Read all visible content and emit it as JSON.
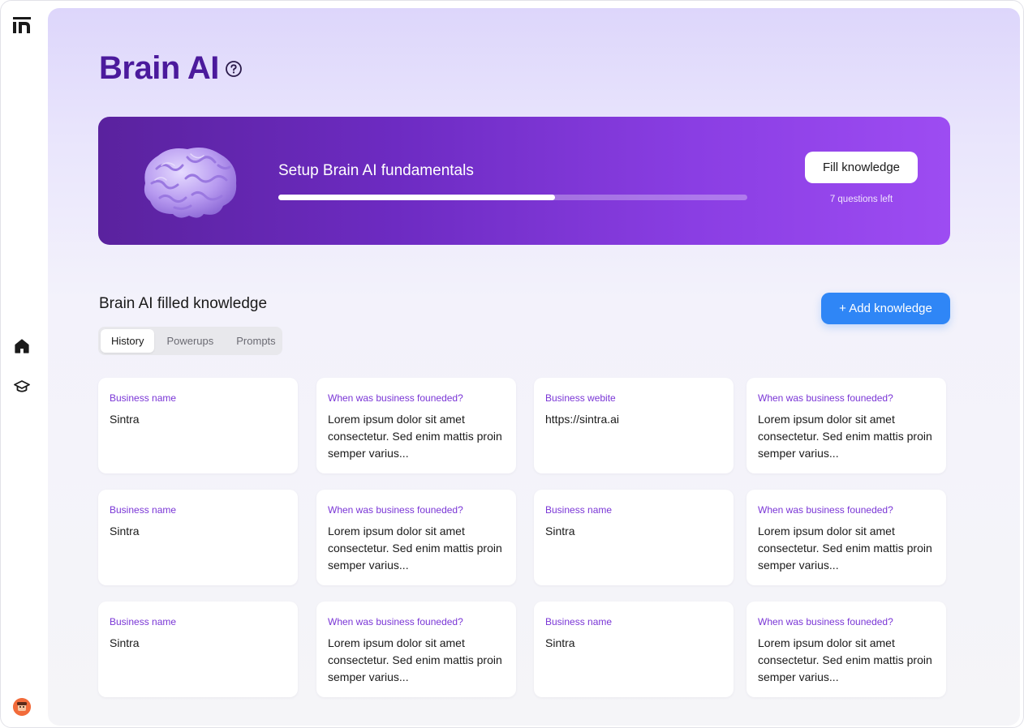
{
  "page": {
    "title": "Brain AI"
  },
  "banner": {
    "title": "Setup Brain AI fundamentals",
    "progress": 0.59,
    "button_label": "Fill knowledge",
    "questions_left": "7 questions left"
  },
  "section": {
    "title": "Brain AI filled knowledge",
    "add_button_label": "+ Add knowledge",
    "tabs": [
      {
        "label": "History",
        "active": true
      },
      {
        "label": "Powerups",
        "active": false
      },
      {
        "label": "Prompts",
        "active": false
      }
    ]
  },
  "cards": [
    {
      "label": "Business name",
      "value": "Sintra"
    },
    {
      "label": "When was business founeded?",
      "value": "Lorem ipsum dolor sit amet consectetur. Sed enim mattis proin semper varius..."
    },
    {
      "label": "Business webite",
      "value": "https://sintra.ai"
    },
    {
      "label": "When was business founeded?",
      "value": "Lorem ipsum dolor sit amet consectetur. Sed enim mattis proin semper varius..."
    },
    {
      "label": "Business name",
      "value": "Sintra"
    },
    {
      "label": "When was business founeded?",
      "value": "Lorem ipsum dolor sit amet consectetur. Sed enim mattis proin semper varius..."
    },
    {
      "label": "Business name",
      "value": "Sintra"
    },
    {
      "label": "When was business founeded?",
      "value": "Lorem ipsum dolor sit amet consectetur. Sed enim mattis proin semper varius..."
    },
    {
      "label": "Business name",
      "value": "Sintra"
    },
    {
      "label": "When was business founeded?",
      "value": "Lorem ipsum dolor sit amet consectetur. Sed enim mattis proin semper varius..."
    },
    {
      "label": "Business name",
      "value": "Sintra"
    },
    {
      "label": "When was business founeded?",
      "value": "Lorem ipsum dolor sit amet consectetur. Sed enim mattis proin semper varius..."
    }
  ],
  "sidebar": {
    "icons": [
      "logo-icon",
      "home-icon",
      "graduation-cap-icon",
      "avatar"
    ]
  },
  "colors": {
    "title": "#4b1a9c",
    "accent": "#7a36d6",
    "primary_button": "#2f86f6",
    "banner_start": "#5a229e",
    "banner_end": "#9d4cf2"
  }
}
